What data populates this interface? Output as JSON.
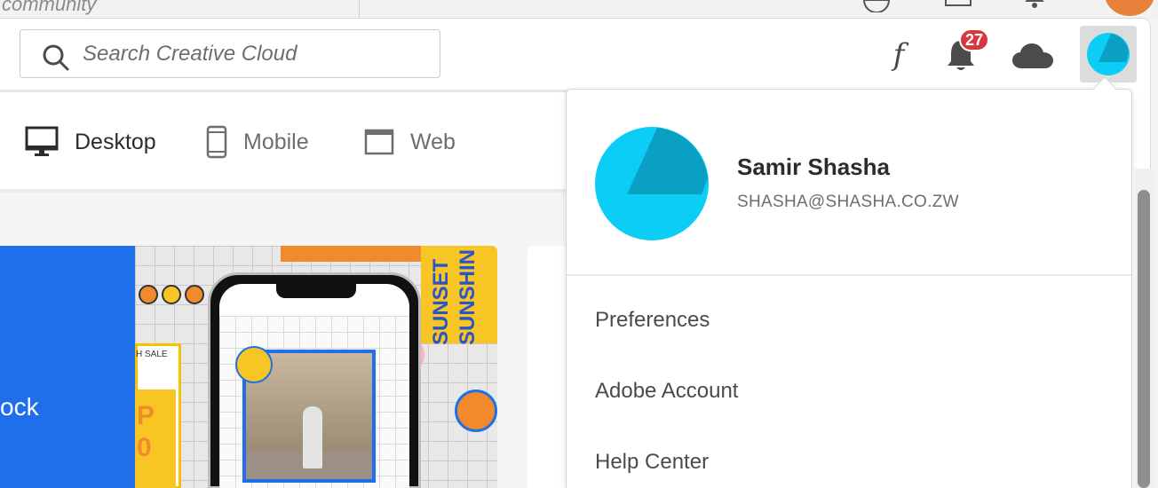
{
  "background": {
    "partial_text": "community"
  },
  "search": {
    "placeholder": "Search Creative Cloud",
    "icon": "search-icon"
  },
  "toolbar": {
    "fonts_label": "f",
    "notifications_count": "27",
    "icons": [
      "fonts-icon",
      "bell-icon",
      "cloud-icon",
      "avatar"
    ]
  },
  "tabs": [
    {
      "label": "Desktop",
      "icon": "desktop-icon",
      "selected": true
    },
    {
      "label": "Mobile",
      "icon": "mobile-icon",
      "selected": false
    },
    {
      "label": "Web",
      "icon": "web-icon",
      "selected": false
    }
  ],
  "banner": {
    "partial_label": "ock",
    "vertical_text": "SUNSET SUNSHIN",
    "sale_text": "H SALE",
    "sale_digits": "P\n0"
  },
  "profile_menu": {
    "name": "Samir Shasha",
    "email": "SHASHA@SHASHA.CO.ZW",
    "items": [
      "Preferences",
      "Adobe Account",
      "Help Center"
    ]
  },
  "colors": {
    "accent_blue": "#1f6fea",
    "avatar_cyan": "#0ccdf5",
    "avatar_dark": "#0aa0c4",
    "badge_red": "#d7373f"
  }
}
